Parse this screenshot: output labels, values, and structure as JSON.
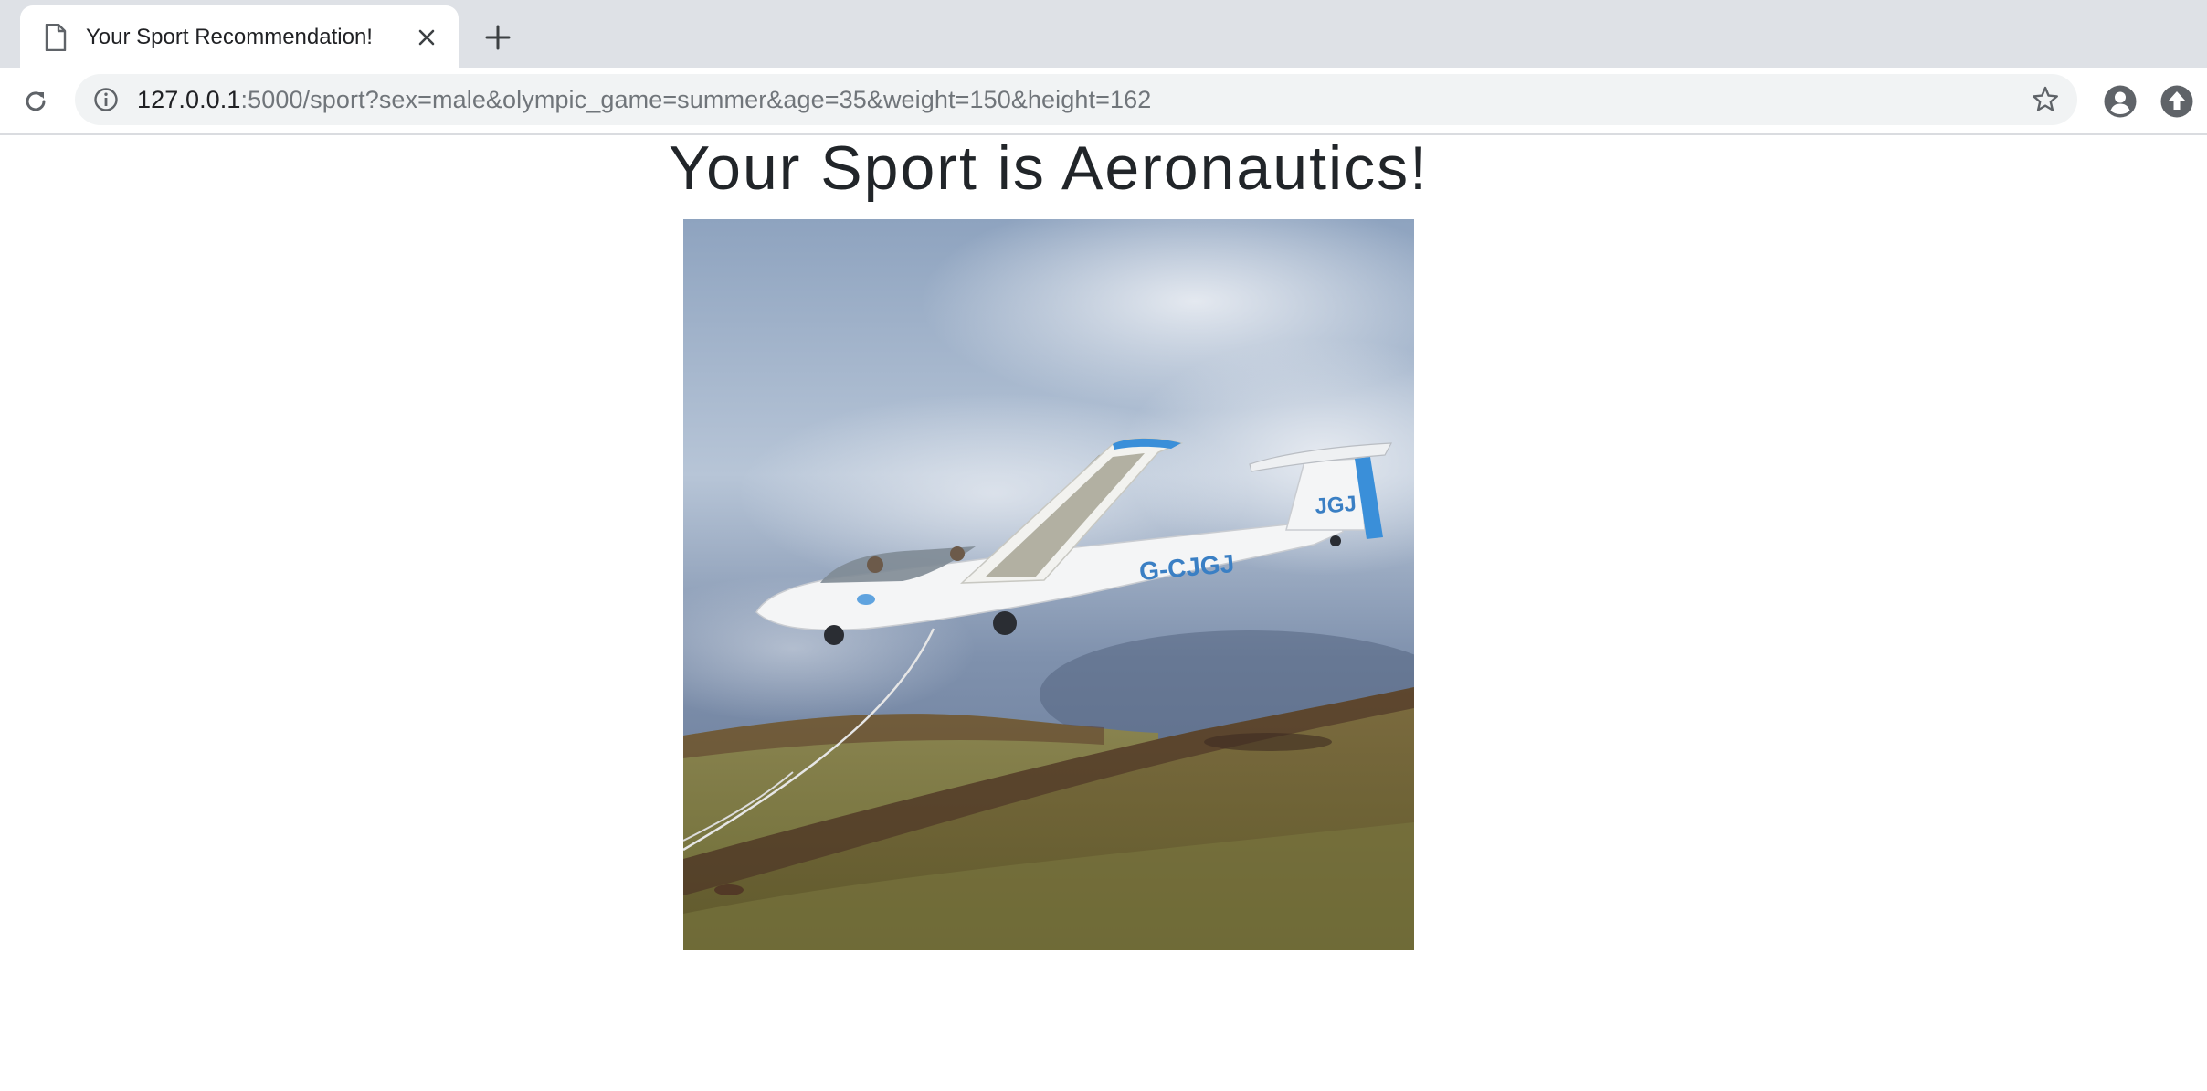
{
  "browser": {
    "tab_title": "Your Sport Recommendation!",
    "url_host": "127.0.0.1",
    "url_rest": ":5000/sport?sex=male&olympic_game=summer&age=35&weight=150&height=162",
    "icons": {
      "tab": "document-icon",
      "close": "close-icon",
      "new_tab": "plus-icon",
      "reload": "reload-icon",
      "site_info": "info-icon",
      "bookmark": "star-icon",
      "profile": "account-icon",
      "update": "update-arrow-icon"
    }
  },
  "page": {
    "headline": "Your Sport is Aeronautics!",
    "photo": {
      "subject": "glider being towed over hillside",
      "registration": "G-CJGJ",
      "tail_code": "JGJ"
    }
  },
  "colors": {
    "tabstrip_bg": "#dee1e6",
    "omnibox_bg": "#f1f3f4",
    "glider_accent": "#3a8fd9"
  }
}
